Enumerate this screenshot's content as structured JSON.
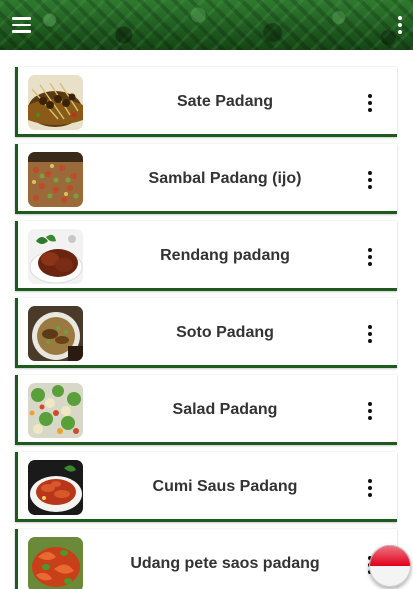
{
  "app_bar": {
    "menu_icon": "hamburger-menu-icon",
    "overflow_icon": "more-vert-icon",
    "background_color": "#1f5a1f"
  },
  "recipes": [
    {
      "title": "Sate Padang",
      "image": "sate-padang-photo"
    },
    {
      "title": "Sambal Padang (ijo)",
      "image": "sambal-padang-photo"
    },
    {
      "title": "Rendang padang",
      "image": "rendang-padang-photo"
    },
    {
      "title": "Soto Padang",
      "image": "soto-padang-photo"
    },
    {
      "title": "Salad Padang",
      "image": "salad-padang-photo"
    },
    {
      "title": "Cumi Saus Padang",
      "image": "cumi-saus-padang-photo"
    },
    {
      "title": "Udang pete saos padang",
      "image": "udang-pete-saos-padang-photo"
    }
  ],
  "language_button": {
    "icon": "indonesia-flag-icon",
    "colors": [
      "#e0001b",
      "#ffffff"
    ]
  },
  "accent_color": "#1e5a1e"
}
